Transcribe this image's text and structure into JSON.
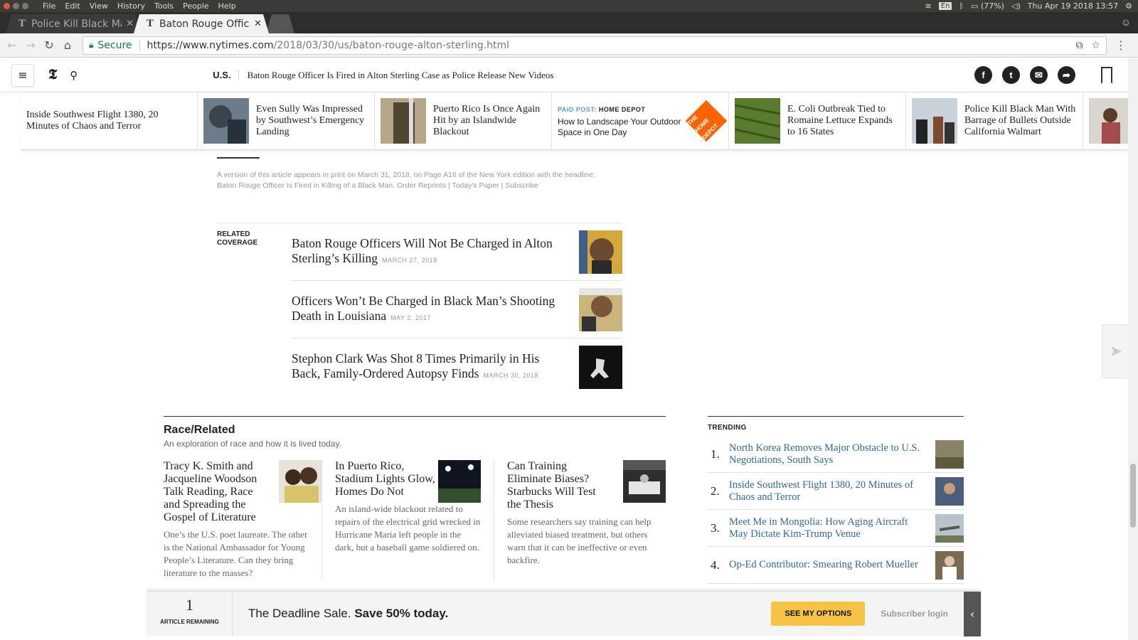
{
  "system": {
    "menu": [
      "File",
      "Edit",
      "View",
      "History",
      "Tools",
      "People",
      "Help"
    ],
    "lang": "En",
    "battery": "(77%)",
    "clock": "Thu Apr 19 2018 13:57"
  },
  "tabs": [
    {
      "title": "Police Kill Black Ma",
      "icon": "T"
    },
    {
      "title": "Baton Rouge Office",
      "icon": "T"
    }
  ],
  "address": {
    "secure_label": "Secure",
    "url_host": "https://www.nytimes.com",
    "url_path": "/2018/03/30/us/baton-rouge-alton-sterling.html"
  },
  "header": {
    "section": "U.S.",
    "title": "Baton Rouge Officer Is Fired in Alton Sterling Case as Police Release New Videos"
  },
  "ribbon": [
    {
      "title": "Inside Southwest Flight 1380, 20 Minutes of Chaos and Terror"
    },
    {
      "title": "Even Sully Was Impressed by Southwest’s Emergency Landing"
    },
    {
      "title": "Puerto Rico Is Once Again Hit by an Islandwide Blackout"
    },
    {
      "ad_prefix": "PAID POST:",
      "ad_brand": "HOME DEPOT",
      "title": "How to Landscape Your Outdoor Space in One Day",
      "ad_logo_text": "THE HOME DEPOT"
    },
    {
      "title": "E. Coli Outbreak Tied to Romaine Lettuce Expands to 16 States"
    },
    {
      "title": "Police Kill Black Man With Barrage of Bullets Outside California Walmart"
    }
  ],
  "print_note": "A version of this article appears in print on March 31, 2018, on Page A16 of the New York edition with the headline: Baton Rouge Officer Is Fired in Killing of a Black Man. Order Reprints | Today's Paper | Subscribe",
  "related": {
    "label": "RELATED COVERAGE",
    "items": [
      {
        "title": "Baton Rouge Officers Will Not Be Charged in Alton Sterling’s Killing",
        "date": "MARCH 27, 2018"
      },
      {
        "title": "Officers Won’t Be Charged in Black Man’s Shooting Death in Louisiana",
        "date": "MAY 2, 2017"
      },
      {
        "title": "Stephon Clark Was Shot 8 Times Primarily in His Back, Family-Ordered Autopsy Finds",
        "date": "MARCH 30, 2018"
      }
    ]
  },
  "race_related": {
    "title": "Race/Related",
    "subtitle": "An exploration of race and how it is lived today.",
    "items": [
      {
        "title": "Tracy K. Smith and Jacqueline Woodson Talk Reading, Race and Spreading the Gospel of Literature",
        "summary": "One’s the U.S. poet laureate. The other is the National Ambassador for Young People’s Literature. Can they bring literature to the masses?"
      },
      {
        "title": "In Puerto Rico, Stadium Lights Glow, Homes Do Not",
        "summary": "An island-wide blackout related to repairs of the electrical grid wrecked in Hurricane Maria left people in the dark, but a baseball game soldiered on."
      },
      {
        "title": "Can Training Eliminate Biases? Starbucks Will Test the Thesis",
        "summary": "Some researchers say training can help alleviated biased treatment, but others warn that it can be ineffective or even backfire."
      }
    ]
  },
  "trending": {
    "label": "TRENDING",
    "items": [
      {
        "num": "1.",
        "title": "North Korea Removes Major Obstacle to U.S. Negotiations, South Says"
      },
      {
        "num": "2.",
        "title": "Inside Southwest Flight 1380, 20 Minutes of Chaos and Terror"
      },
      {
        "num": "3.",
        "title": "Meet Me in Mongolia: How Aging Aircraft May Dictate Kim-Trump Venue"
      },
      {
        "num": "4.",
        "title": "Op-Ed Contributor: Smearing Robert Mueller"
      }
    ]
  },
  "paywall": {
    "count": "1",
    "count_label": "ARTICLE REMAINING",
    "msg_plain": "The Deadline Sale.",
    "msg_bold": "Save 50% today.",
    "button": "SEE MY OPTIONS",
    "login": "Subscriber login"
  }
}
